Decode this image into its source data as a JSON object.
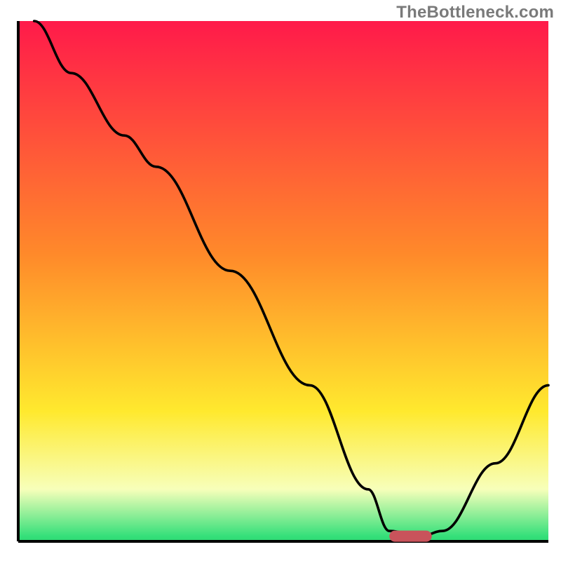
{
  "watermark": "TheBottleneck.com",
  "colors": {
    "gradient_top": "#ff1a4a",
    "gradient_mid1": "#ff8a2a",
    "gradient_mid2": "#ffe92e",
    "gradient_bottom_band": "#f7ffba",
    "gradient_green": "#35e07a",
    "curve": "#000000",
    "marker": "#c9535b",
    "axis": "#000000"
  },
  "chart_data": {
    "type": "line",
    "title": "",
    "xlabel": "",
    "ylabel": "",
    "xlim": [
      0,
      100
    ],
    "ylim": [
      0,
      100
    ],
    "x": [
      3,
      10,
      20,
      26,
      40,
      55,
      66,
      70,
      76,
      80,
      90,
      100
    ],
    "values": [
      100,
      90,
      78,
      72,
      52,
      30,
      10,
      2,
      1,
      2,
      15,
      30
    ],
    "marker": {
      "x_start": 70,
      "x_end": 78,
      "y": 1
    },
    "annotations": []
  }
}
